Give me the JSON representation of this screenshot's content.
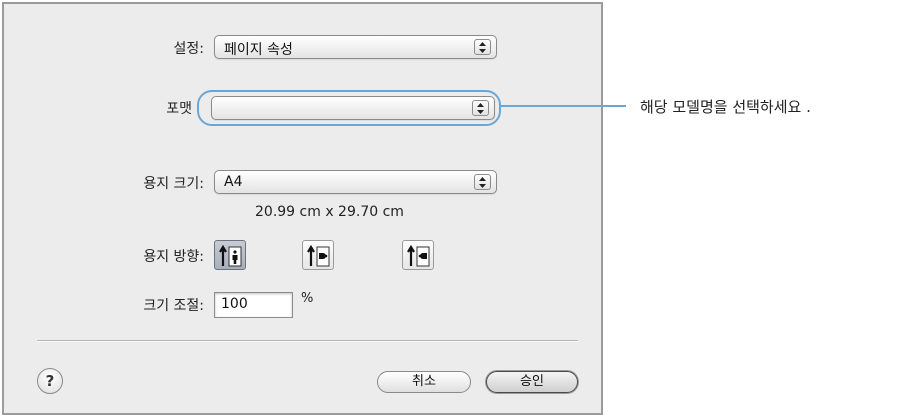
{
  "dialog": {
    "settings": {
      "label": "설정:",
      "value": "페이지 속성"
    },
    "format": {
      "label": "포맷",
      "value": ""
    },
    "paper_size": {
      "label": "용지 크기:",
      "value": "A4",
      "dimensions": "20.99 cm x 29.70 cm"
    },
    "orientation": {
      "label": "용지 방향:",
      "options": [
        {
          "icon": "portrait-orientation-icon",
          "selected": true
        },
        {
          "icon": "landscape-left-orientation-icon",
          "selected": false
        },
        {
          "icon": "landscape-right-orientation-icon",
          "selected": false
        }
      ]
    },
    "scale": {
      "label": "크기 조절:",
      "value": "100",
      "unit": "%"
    },
    "help_label": "?",
    "cancel_label": "취소",
    "ok_label": "승인"
  },
  "annotation": {
    "text": "해당 모델명을 선택하세요 .",
    "color": "#69a7d8"
  },
  "icons": {
    "popup_arrows": "up-down-arrows-icon"
  }
}
